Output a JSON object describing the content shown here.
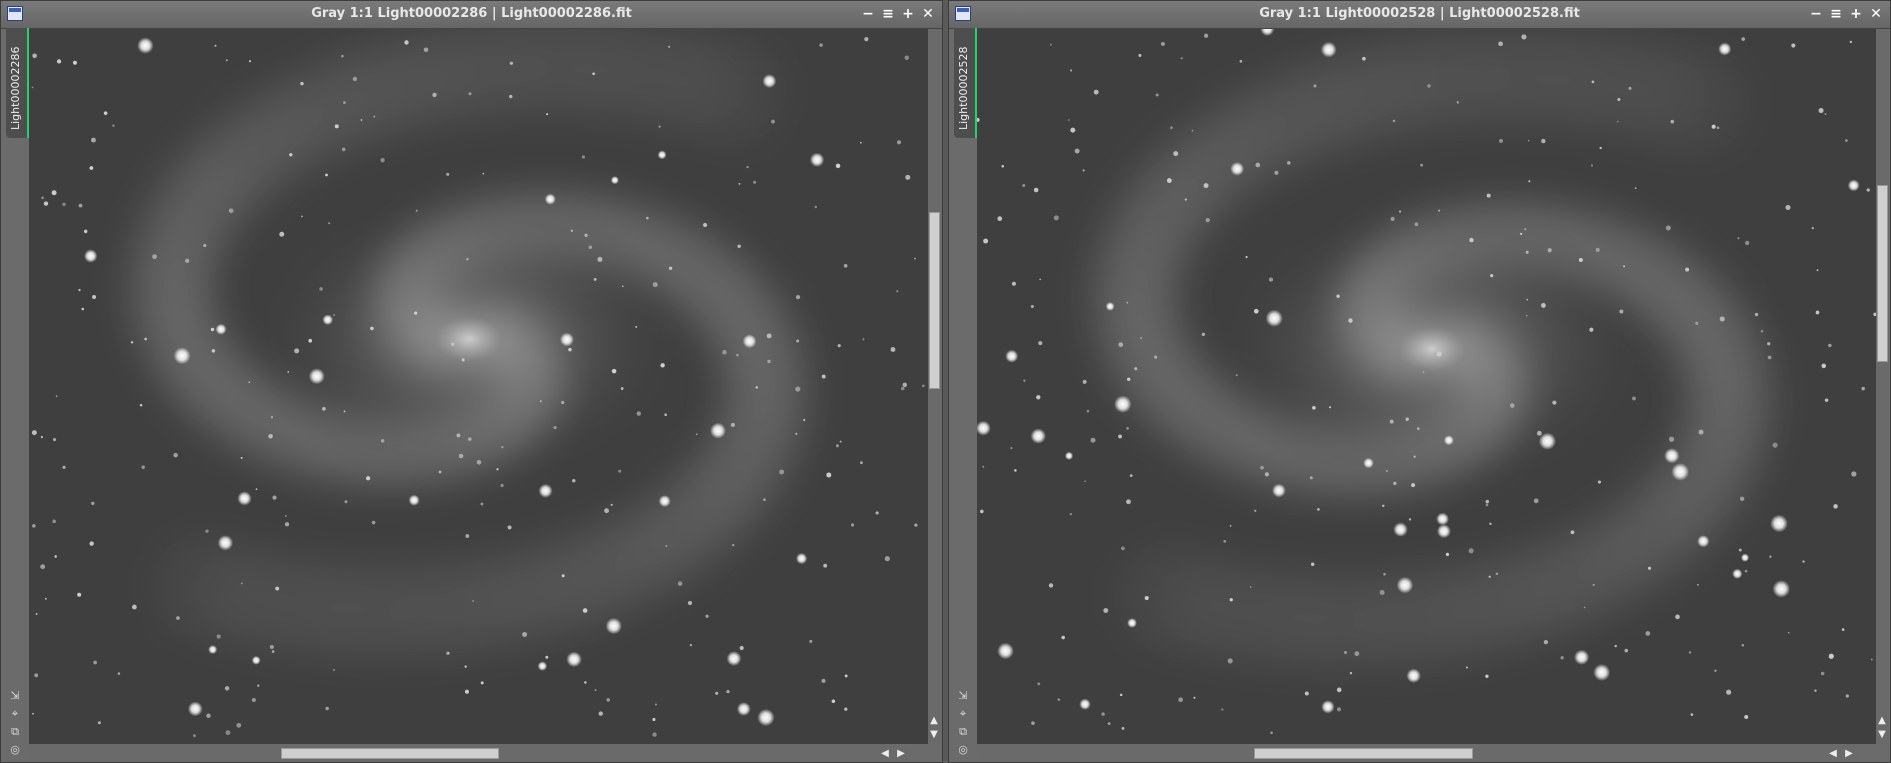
{
  "windows": [
    {
      "title": "Gray 1:1 Light00002286 | Light00002286.fit",
      "side_tab": "Light00002286"
    },
    {
      "title": "Gray 1:1 Light00002528 | Light00002528.fit",
      "side_tab": "Light00002528"
    }
  ],
  "titlebar_buttons": [
    "minimize-icon",
    "shade-icon",
    "maximize-icon",
    "close-icon"
  ],
  "titlebar_glyphs": [
    "−",
    "≡",
    "+",
    "✕"
  ],
  "side_icon_glyphs": [
    "⇲",
    "⌖",
    "⧉",
    "◎"
  ],
  "scroll_glyphs": {
    "up": "▲",
    "down": "▼",
    "left": "◀",
    "right": "▶"
  },
  "scroll": {
    "left": {
      "v_start": 0.27,
      "v_size": 0.26,
      "h_start": 0.3,
      "h_size": 0.26
    },
    "right": {
      "v_start": 0.23,
      "v_size": 0.26,
      "h_start": 0.33,
      "h_size": 0.26
    }
  },
  "colors": {
    "frame": "#6b6b6b",
    "active_tab_accent": "#2ecc71",
    "sky": "#3e3e3e"
  }
}
